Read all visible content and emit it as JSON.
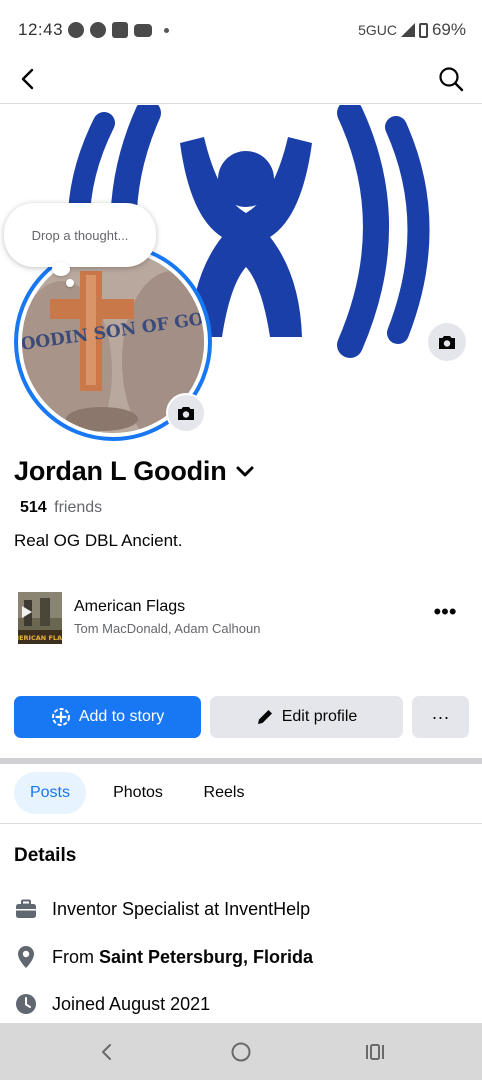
{
  "status_bar": {
    "time": "12:43",
    "network": "5GUC",
    "battery": "69%",
    "notification_icons": [
      "messenger-icon",
      "messenger-icon",
      "linkedin-icon",
      "youtube-icon"
    ]
  },
  "header": {
    "back_icon": "back-arrow-icon",
    "search_icon": "search-icon"
  },
  "profile": {
    "thought_placeholder": "Drop a thought...",
    "name": "Jordan L Goodin",
    "friends_count": "514",
    "friends_label": "friends",
    "bio": "Real OG DBL Ancient.",
    "avatar_tattoo_text": "GOODIN SON OF GOD"
  },
  "music": {
    "title": "American Flags",
    "artist": "Tom MacDonald, Adam Calhoun",
    "album_art_text": "MERICAN FLAG"
  },
  "actions": {
    "add_story": "Add to story",
    "edit_profile": "Edit profile",
    "more": "···"
  },
  "tabs": [
    {
      "label": "Posts",
      "active": true
    },
    {
      "label": "Photos",
      "active": false
    },
    {
      "label": "Reels",
      "active": false
    }
  ],
  "details": {
    "title": "Details",
    "work": "Inventor Specialist at InventHelp",
    "from_prefix": "From",
    "from_place": "Saint Petersburg, Florida",
    "joined": "Joined August 2021"
  },
  "colors": {
    "accent": "#1877f2",
    "cover_logo": "#1a3fa8",
    "secondary_text": "#65676b",
    "button_grey": "#e4e6eb"
  }
}
